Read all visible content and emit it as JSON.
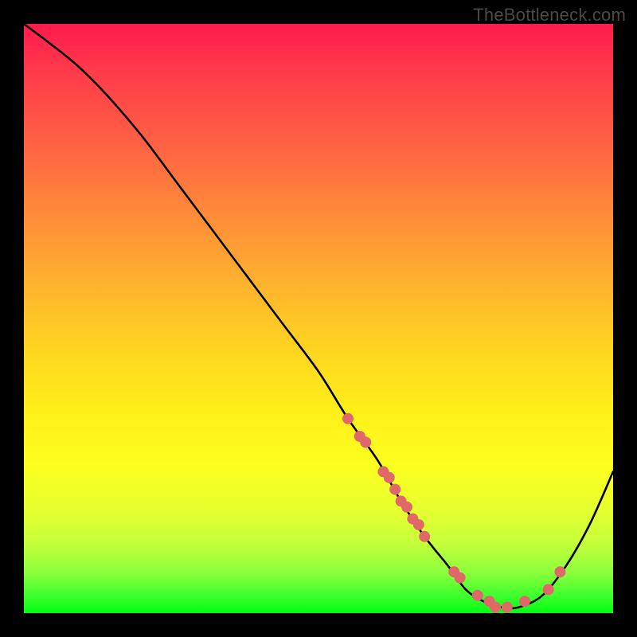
{
  "watermark": "TheBottleneck.com",
  "colors": {
    "curve": "#000000",
    "dot": "#e06868",
    "frame": "#000000"
  },
  "chart_data": {
    "type": "line",
    "title": "",
    "xlabel": "",
    "ylabel": "",
    "xlim": [
      0,
      100
    ],
    "ylim": [
      0,
      100
    ],
    "grid": false,
    "annotations": [
      "TheBottleneck.com"
    ],
    "series": [
      {
        "name": "bottleneck-curve",
        "x": [
          0,
          4,
          9,
          14,
          20,
          26,
          32,
          38,
          44,
          50,
          55,
          60,
          64,
          68,
          72,
          75,
          78,
          81,
          84,
          88,
          92,
          96,
          100
        ],
        "y": [
          100,
          97,
          93,
          88,
          81,
          73,
          65,
          57,
          49,
          41,
          33,
          26,
          19,
          13,
          8,
          4,
          2,
          1,
          1,
          3,
          8,
          15,
          24
        ]
      }
    ],
    "scatter_points": {
      "name": "highlighted-points",
      "x": [
        55,
        57,
        58,
        61,
        62,
        63,
        64,
        65,
        66,
        67,
        68,
        73,
        74,
        77,
        79,
        80,
        82,
        85,
        89,
        91
      ],
      "y": [
        33,
        30,
        29,
        24,
        23,
        21,
        19,
        18,
        16,
        15,
        13,
        7,
        6,
        3,
        2,
        1,
        1,
        2,
        4,
        7
      ]
    }
  }
}
